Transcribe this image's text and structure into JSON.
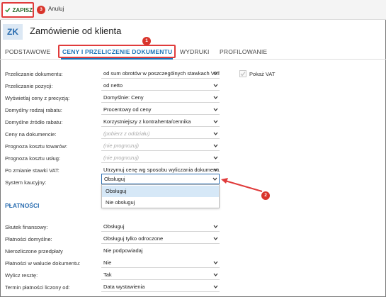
{
  "toolbar": {
    "save_label": "ZAPISZ",
    "save_badge": "3",
    "cancel_label": "Anuluj"
  },
  "header": {
    "doc_code": "ZK",
    "title": "Zamówienie od klienta"
  },
  "tabs": [
    {
      "label": "PODSTAWOWE"
    },
    {
      "label": "CENY I PRZELICZENIE DOKUMENTU"
    },
    {
      "label": "WYDRUKI"
    },
    {
      "label": "PROFILOWANIE"
    }
  ],
  "tab_badge": "1",
  "show_vat_label": "Pokaż VAT",
  "rows": [
    {
      "label": "Przeliczanie dokumentu:",
      "value": "od sum obrotów w poszczególnych stawkach VAT"
    },
    {
      "label": "Przeliczanie pozycji:",
      "value": "od netto"
    },
    {
      "label": "Wyświetlaj ceny z precyzją:",
      "value": "Domyślnie: Ceny"
    },
    {
      "label": "Domyślny rodzaj rabatu:",
      "value": "Procentowy od ceny"
    },
    {
      "label": "Domyślne źródło rabatu:",
      "value": "Korzystniejszy z kontrahenta/cennika"
    },
    {
      "label": "Ceny na dokumencie:",
      "value": "(pobierz z oddziału)"
    },
    {
      "label": "Prognoza kosztu towarów:",
      "value": "(nie prognozuj)"
    },
    {
      "label": "Prognoza kosztu usług:",
      "value": "(nie prognozuj)"
    },
    {
      "label": "Po zmianie stawki VAT:",
      "value": "Utrzymuj cenę wg sposobu wyliczania dokumentu"
    },
    {
      "label": "System kaucyjny:",
      "value": "Obsługuj"
    }
  ],
  "dropdown_options": [
    "Obsługuj",
    "Nie obsługuj"
  ],
  "arrow_badge": "2",
  "payments_title": "PŁATNOŚCI",
  "payment_rows": [
    {
      "label": "Skutek finansowy:",
      "value": "Obsługuj"
    },
    {
      "label": "Płatności domyślne:",
      "value": "Obsługuj tylko odroczone"
    },
    {
      "label": "Nierozliczone przedpłaty",
      "value": "Nie podpowiadaj"
    },
    {
      "label": "Płatności w walucie dokumentu:",
      "value": "Nie"
    },
    {
      "label": "Wylicz resztę:",
      "value": "Tak"
    },
    {
      "label": "Termin płatności liczony od:",
      "value": "Data wystawienia"
    }
  ],
  "colors": {
    "accent": "#1a73b8",
    "highlight": "#e03b3b",
    "selected": "#d6e8f7"
  }
}
